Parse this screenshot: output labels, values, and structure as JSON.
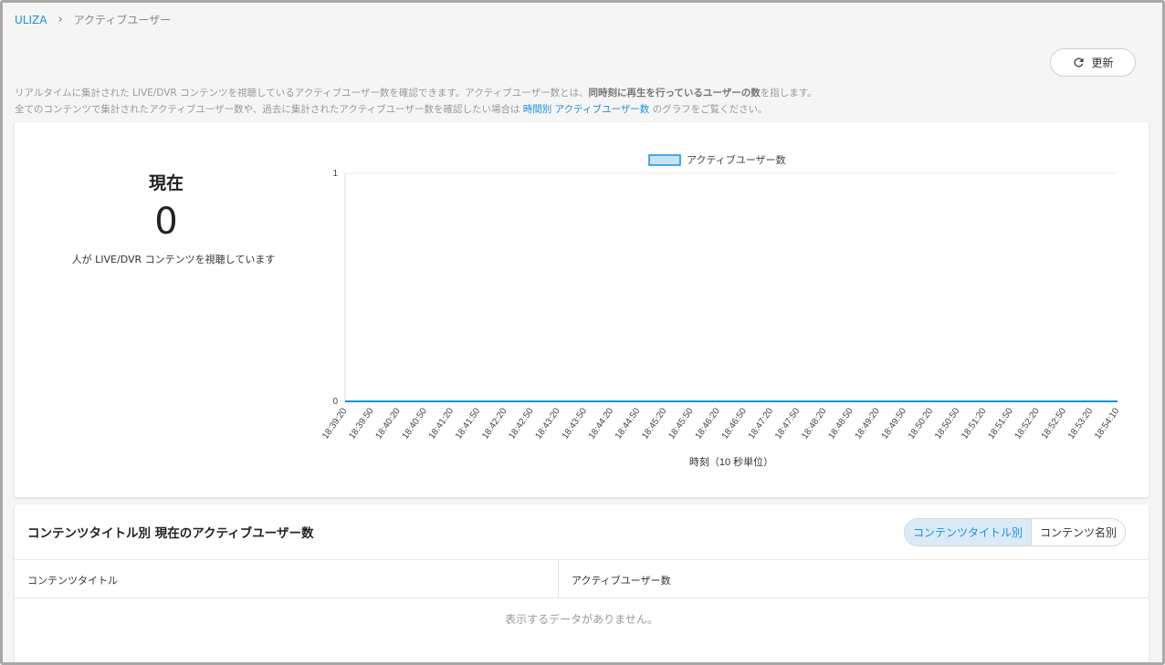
{
  "breadcrumb": {
    "root": "ULIZA",
    "separator": "›",
    "current": "アクティブユーザー"
  },
  "refresh": {
    "label": "更新",
    "icon": "refresh-icon"
  },
  "description": {
    "line1_a": "リアルタイムに集計された LIVE/DVR コンテンツを視聴しているアクティブユーザー数を確認できます。アクティブユーザー数とは、",
    "line1_bold": "同時刻に再生を行っているユーザーの数",
    "line1_b": "を指します。",
    "line2_a": "全てのコンテンツで集計されたアクティブユーザー数や、過去に集計されたアクティブユーザー数を確認したい場合は ",
    "line2_link": "時間別 アクティブユーザー数",
    "line2_b": " のグラフをご覧ください。"
  },
  "current": {
    "label": "現在",
    "value": "0",
    "caption": "人が LIVE/DVR コンテンツを視聴しています"
  },
  "chart_data": {
    "type": "line",
    "x": [
      "18:39:20",
      "18:39:50",
      "18:40:20",
      "18:40:50",
      "18:41:20",
      "18:41:50",
      "18:42:20",
      "18:42:50",
      "18:43:20",
      "18:43:50",
      "18:44:20",
      "18:44:50",
      "18:45:20",
      "18:45:50",
      "18:46:20",
      "18:46:50",
      "18:47:20",
      "18:47:50",
      "18:48:20",
      "18:48:50",
      "18:49:20",
      "18:49:50",
      "18:50:20",
      "18:50:50",
      "18:51:20",
      "18:51:50",
      "18:52:20",
      "18:52:50",
      "18:53:20",
      "18:54:10"
    ],
    "series": [
      {
        "name": "アクティブユーザー数",
        "values": [
          0,
          0,
          0,
          0,
          0,
          0,
          0,
          0,
          0,
          0,
          0,
          0,
          0,
          0,
          0,
          0,
          0,
          0,
          0,
          0,
          0,
          0,
          0,
          0,
          0,
          0,
          0,
          0,
          0,
          0
        ]
      }
    ],
    "xlabel": "時刻（10 秒単位）",
    "ylabel": "",
    "ylim": [
      0,
      1
    ],
    "yticks": [
      "0",
      "1"
    ],
    "legend": "top-center",
    "colors": {
      "line": "#1a8fdb",
      "legend_fill": "#c6e4f7",
      "grid": "#e8e8e8"
    }
  },
  "table": {
    "title": "コンテンツタイトル別 現在のアクティブユーザー数",
    "toggle": {
      "active": "コンテンツタイトル別",
      "inactive": "コンテンツ名別"
    },
    "columns": [
      "コンテンツタイトル",
      "アクティブユーザー数"
    ],
    "rows": [],
    "empty_message": "表示するデータがありません。"
  }
}
